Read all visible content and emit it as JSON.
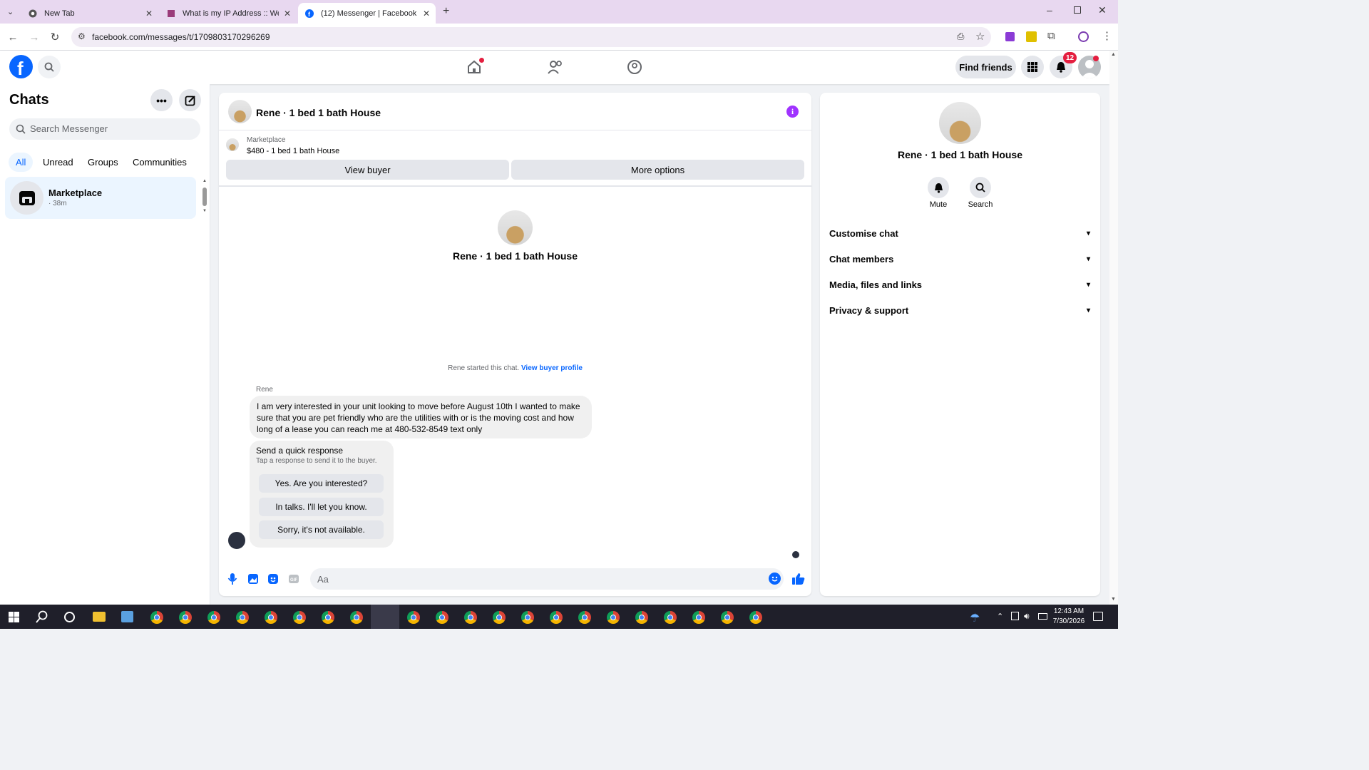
{
  "browser": {
    "tabs": [
      {
        "label": "New Tab"
      },
      {
        "label": "What is my IP Address :: WebBr"
      },
      {
        "label": "(12) Messenger | Facebook"
      }
    ],
    "url": "facebook.com/messages/t/1709803170296269"
  },
  "fb": {
    "find_friends": "Find friends",
    "notification_count": "12"
  },
  "chats": {
    "title": "Chats",
    "search_placeholder": "Search Messenger",
    "filters": [
      "All",
      "Unread",
      "Groups",
      "Communities"
    ],
    "items": [
      {
        "name": "Marketplace",
        "meta": "· 38m"
      }
    ]
  },
  "conversation": {
    "title": "Rene · 1 bed 1 bath House",
    "listing": {
      "source": "Marketplace",
      "detail": "$480 - 1 bed 1 bath House"
    },
    "view_buyer": "View buyer",
    "more_options": "More options",
    "intro_name": "Rene · 1 bed 1 bath House",
    "started_text": "Rene started this chat.",
    "view_buyer_profile": "View buyer profile",
    "sender": "Rene",
    "message": "I am very interested in your unit looking to move before August 10th I wanted to make sure that you are pet friendly who are the utilities with or is the moving cost and how long of a lease you can reach me at 480-532-8549 text only",
    "quick": {
      "title": "Send a quick response",
      "subtitle": "Tap a response to send it to the buyer.",
      "options": [
        "Yes. Are you interested?",
        "In talks. I'll let you know.",
        "Sorry, it's not available."
      ]
    },
    "composer_placeholder": "Aa"
  },
  "details": {
    "name": "Rene · 1 bed 1 bath House",
    "mute": "Mute",
    "search": "Search",
    "sections": [
      "Customise chat",
      "Chat members",
      "Media, files and links",
      "Privacy & support"
    ]
  },
  "taskbar": {
    "time": "12:43 AM",
    "date": "7/30/2026"
  },
  "colors": {
    "fb_blue": "#0866ff",
    "selected_chat_bg": "#ebf5ff",
    "info_purple": "#a033ff"
  }
}
